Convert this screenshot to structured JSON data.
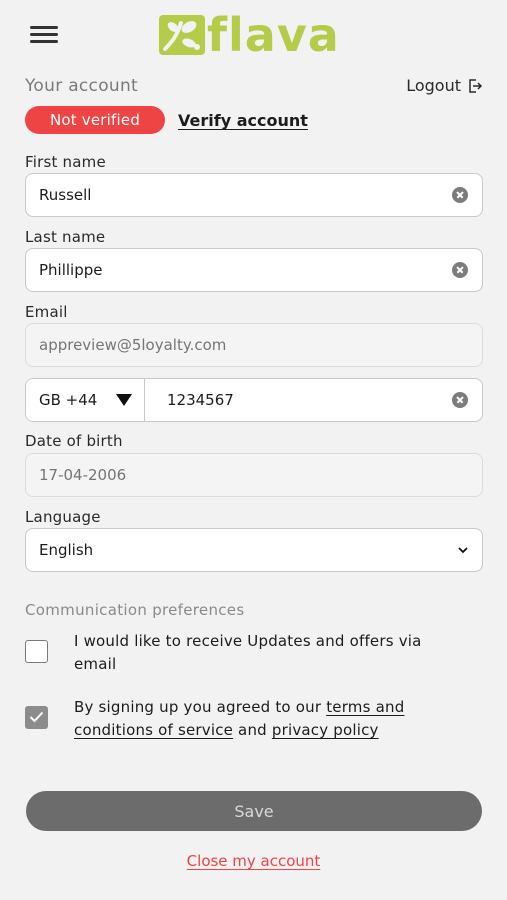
{
  "header": {
    "logo_text": "flava",
    "brand_color": "#b5cc4a"
  },
  "account": {
    "section_title": "Your account",
    "logout_label": "Logout",
    "status_badge": "Not verified",
    "verify_link": "Verify account"
  },
  "form": {
    "first_name": {
      "label": "First name",
      "value": "Russell"
    },
    "last_name": {
      "label": "Last name",
      "value": "Phillippe"
    },
    "email": {
      "label": "Email",
      "placeholder": "appreview@5loyalty.com"
    },
    "phone": {
      "country_code": "GB +44",
      "number": "1234567"
    },
    "dob": {
      "label": "Date of birth",
      "placeholder": "17-04-2006"
    },
    "language": {
      "label": "Language",
      "selected": "English"
    }
  },
  "preferences": {
    "title": "Communication preferences",
    "updates_text": "I would like to receive Updates and offers via email",
    "updates_checked": false,
    "terms_prefix": "By signing up you agreed to our ",
    "terms_link": "terms and conditions of service",
    "terms_middle": " and ",
    "privacy_link": "privacy policy",
    "terms_checked": true
  },
  "actions": {
    "save_label": "Save",
    "close_account_label": "Close my account"
  },
  "colors": {
    "danger": "#ef4444",
    "button_disabled": "#6c6c6c"
  }
}
